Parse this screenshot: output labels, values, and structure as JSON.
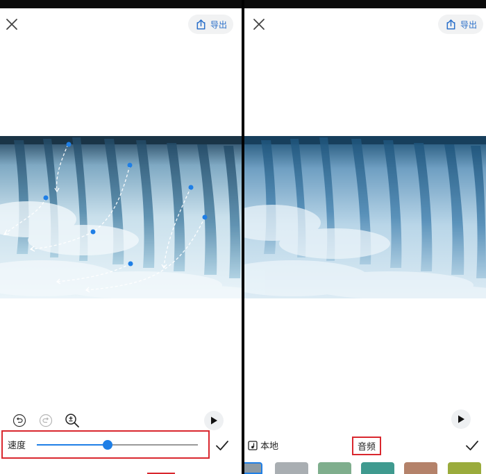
{
  "left_panel": {
    "export_label": "导出",
    "speed_label": "速度",
    "speed_level": 0.44
  },
  "right_panel": {
    "export_label": "导出",
    "local_label": "本地",
    "audio_tab_label": "音频"
  },
  "icons": {
    "close": "close-icon",
    "export": "share-export-icon",
    "undo": "undo-icon",
    "redo": "redo-icon",
    "zoom": "zoom-icon",
    "play": "play-icon",
    "check": "check-icon",
    "local": "music-note-icon"
  },
  "colors": {
    "accent": "#1f7fe6",
    "highlight": "#d9272e",
    "export_text": "#2a6fc9"
  }
}
